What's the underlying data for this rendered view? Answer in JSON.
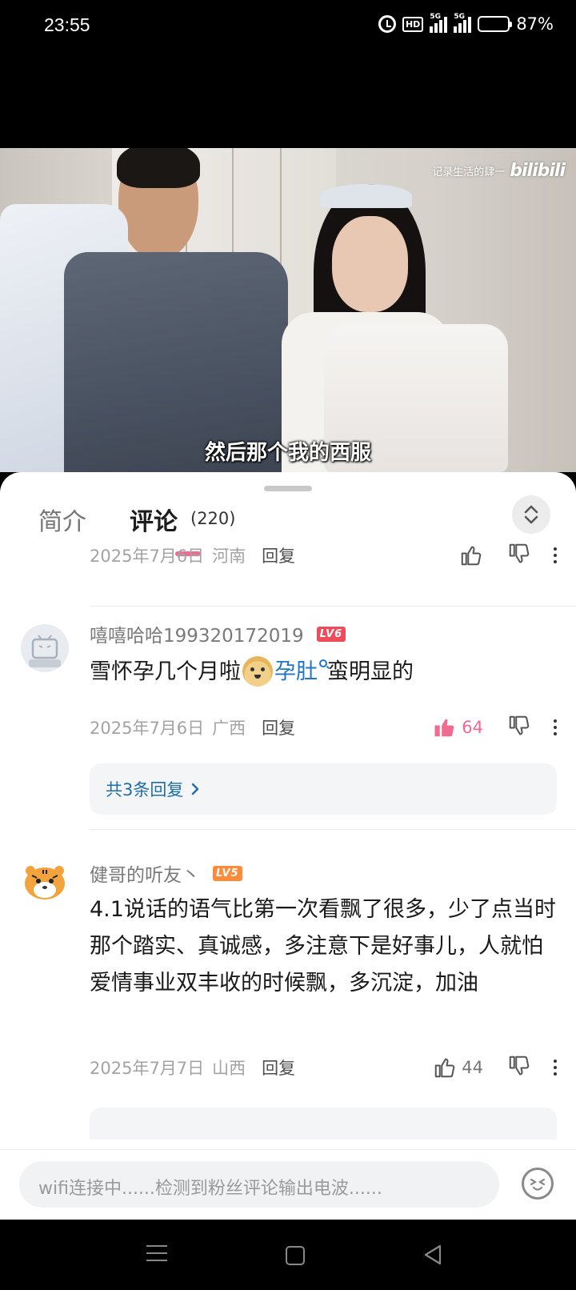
{
  "status_bar": {
    "time": "23:55",
    "network_1": "5G",
    "network_2": "5G",
    "hd_label": "HD",
    "battery": "87%",
    "battery_level": 0.87
  },
  "video": {
    "watermark_text": "记录生活的肆一",
    "watermark_brand": "bilibili",
    "subtitle": "然后那个我的西服"
  },
  "tabs": {
    "intro": "简介",
    "comments": "评论",
    "comment_count": "(220)"
  },
  "top_comment_meta": {
    "date": "2025年7月6日",
    "region": "河南",
    "reply": "回复"
  },
  "comments": [
    {
      "username": "嘻嘻哈哈199320172019",
      "level": "LV6",
      "text_before": "雪怀孕几个月啦",
      "emoji": "doge-emoji",
      "link_word": "孕肚",
      "text_after": "蛮明显的",
      "date": "2025年7月6日",
      "region": "广西",
      "reply": "回复",
      "likes": "64",
      "replies_link": "共3条回复"
    },
    {
      "username": "健哥的听友丶",
      "level": "LV5",
      "text": "4.1说话的语气比第一次看飘了很多，少了点当时那个踏实、真诚感，多注意下是好事儿，人就怕爱情事业双丰收的时候飘，多沉淀，加油",
      "date": "2025年7月7日",
      "region": "山西",
      "reply": "回复",
      "likes": "44"
    }
  ],
  "input": {
    "placeholder": "wifi连接中......检测到粉丝评论输出电波......"
  },
  "colors": {
    "accent_pink": "#f06b91",
    "link_blue": "#1f76c9",
    "lv6": "#ee4b5c",
    "lv5": "#ff8b38"
  }
}
